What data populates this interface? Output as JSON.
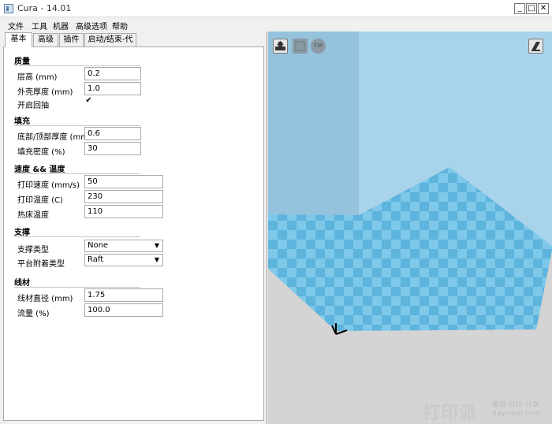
{
  "window": {
    "title": "Cura - 14.01"
  },
  "menu": [
    "文件",
    "工具",
    "机器",
    "高级选项",
    "帮助"
  ],
  "tabs": [
    "基本",
    "高级",
    "插件",
    "启动/结束-代码"
  ],
  "quality": {
    "title": "质量",
    "layer_height_label": "层高 (mm)",
    "layer_height": "0.2",
    "shell_label": "外壳厚度 (mm)",
    "shell": "1.0",
    "retract_label": "开启回抽",
    "retract_mark": "✔"
  },
  "fill": {
    "title": "填充",
    "bottom_top_label": "底部/顶部厚度 (mm)",
    "bottom_top": "0.6",
    "density_label": "填充密度 (%)",
    "density": "30"
  },
  "speed": {
    "title": "速度 && 温度",
    "print_speed_label": "打印速度 (mm/s)",
    "print_speed": "50",
    "print_temp_label": "打印温度 (C)",
    "print_temp": "230",
    "bed_temp_label": "热床温度",
    "bed_temp": "110"
  },
  "support": {
    "title": "支撑",
    "type_label": "支撑类型",
    "type": "None",
    "adhesion_label": "平台附着类型",
    "adhesion": "Raft"
  },
  "filament": {
    "title": "线材",
    "diameter_label": "线材直径 (mm)",
    "diameter": "1.75",
    "flow_label": "流量 (%)",
    "flow": "100.0"
  },
  "viewport": {
    "tm_label": "TM"
  },
  "watermark": {
    "main": "打印派",
    "line1": "模型 打印 分享",
    "line2": "dayinpai.com"
  },
  "colors": {
    "wall_light": "#a6d0e8",
    "floor_a": "#5eb7df",
    "floor_b": "#7ec8e9",
    "ground": "#d4d4d4"
  }
}
